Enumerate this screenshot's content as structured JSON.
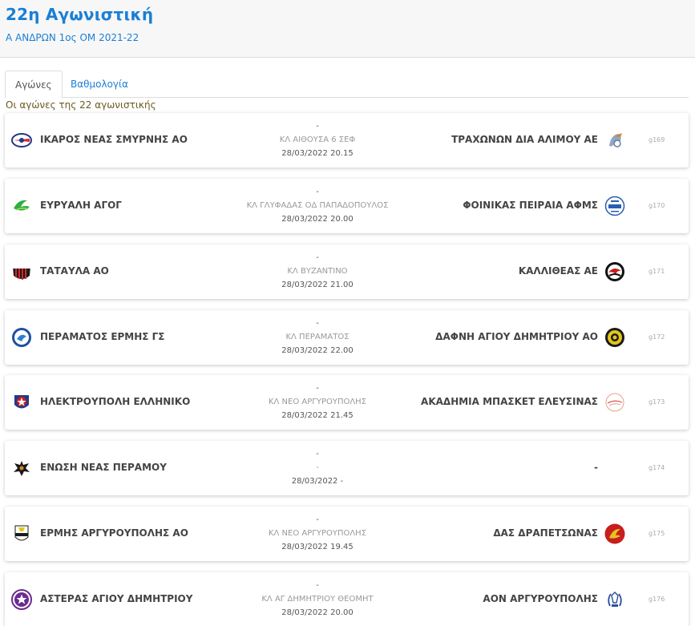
{
  "header": {
    "title": "22η Αγωνιστική",
    "subtitle": "Α ΑΝΔΡΩΝ 1ος ΟΜ 2021-22"
  },
  "tabs": [
    {
      "label": "Αγώνες",
      "active": true
    },
    {
      "label": "Βαθμολογία",
      "active": false
    }
  ],
  "list_title": "Οι αγώνες της 22 αγωνιστικής",
  "matches": [
    {
      "home": "ΙΚΑΡΟΣ ΝΕΑΣ ΣΜΥΡΝΗΣ ΑΟ",
      "score": "-",
      "venue": "ΚΛ ΑΙΘΟΥΣΑ 6 ΣΕΦ",
      "datetime": "28/03/2022 20.15",
      "away": "ΤΡΑΧΩΝΩΝ ΔΙΑ ΑΛΙΜΟΥ ΑΕ",
      "code": "g169"
    },
    {
      "home": "ΕΥΡΥΑΛΗ ΑΓΟΓ",
      "score": "-",
      "venue": "ΚΛ ΓΛΥΦΑΔΑΣ ΟΔ ΠΑΠΑΔΟΠΟΥΛΟΣ",
      "datetime": "28/03/2022 20.00",
      "away": "ΦΟΙΝΙΚΑΣ ΠΕΙΡΑΙΑ ΑΦΜΣ",
      "code": "g170"
    },
    {
      "home": "ΤΑΤΑΥΛΑ ΑΟ",
      "score": "-",
      "venue": "ΚΛ ΒΥΖΑΝΤΙΝΟ",
      "datetime": "28/03/2022 21.00",
      "away": "ΚΑΛΛΙΘΕΑΣ ΑΕ",
      "code": "g171"
    },
    {
      "home": "ΠΕΡΑΜΑΤΟΣ ΕΡΜΗΣ ΓΣ",
      "score": "-",
      "venue": "ΚΛ ΠΕΡΑΜΑΤΟΣ",
      "datetime": "28/03/2022 22.00",
      "away": "ΔΑΦΝΗ ΑΓΙΟΥ ΔΗΜΗΤΡΙΟΥ ΑΟ",
      "code": "g172"
    },
    {
      "home": "ΗΛΕΚΤΡΟΥΠΟΛΗ ΕΛΛΗΝΙΚΟ",
      "score": "-",
      "venue": "ΚΛ ΝΕΟ ΑΡΓΥΡΟΥΠΟΛΗΣ",
      "datetime": "28/03/2022 21.45",
      "away": "ΑΚΑΔΗΜΙΑ ΜΠΑΣΚΕΤ ΕΛΕΥΣΙΝΑΣ",
      "code": "g173"
    },
    {
      "home": "ΕΝΩΣΗ ΝΕΑΣ ΠΕΡΑΜΟΥ",
      "score": "-",
      "venue": "-",
      "datetime": "28/03/2022 -",
      "away": "-",
      "code": "g174"
    },
    {
      "home": "ΕΡΜΗΣ ΑΡΓΥΡΟΥΠΟΛΗΣ ΑΟ",
      "score": "-",
      "venue": "ΚΛ ΝΕΟ ΑΡΓΥΡΟΥΠΟΛΗΣ",
      "datetime": "28/03/2022 19.45",
      "away": "ΔΑΣ ΔΡΑΠΕΤΣΩΝΑΣ",
      "code": "g175"
    },
    {
      "home": "ΑΣΤΕΡΑΣ ΑΓΙΟΥ ΔΗΜΗΤΡΙΟΥ",
      "score": "-",
      "venue": "ΚΛ ΑΓ ΔΗΜΗΤΡΙΟΥ ΘΕΟΜΗΤ",
      "datetime": "28/03/2022 20.00",
      "away": "ΑΟΝ ΑΡΓΥΡΟΥΠΟΛΗΣ",
      "code": "g176"
    }
  ],
  "colors": {
    "accent": "#1a7fd6",
    "subtitle_text": "#6b5a1e",
    "header_bg": "#f7f7f7"
  }
}
